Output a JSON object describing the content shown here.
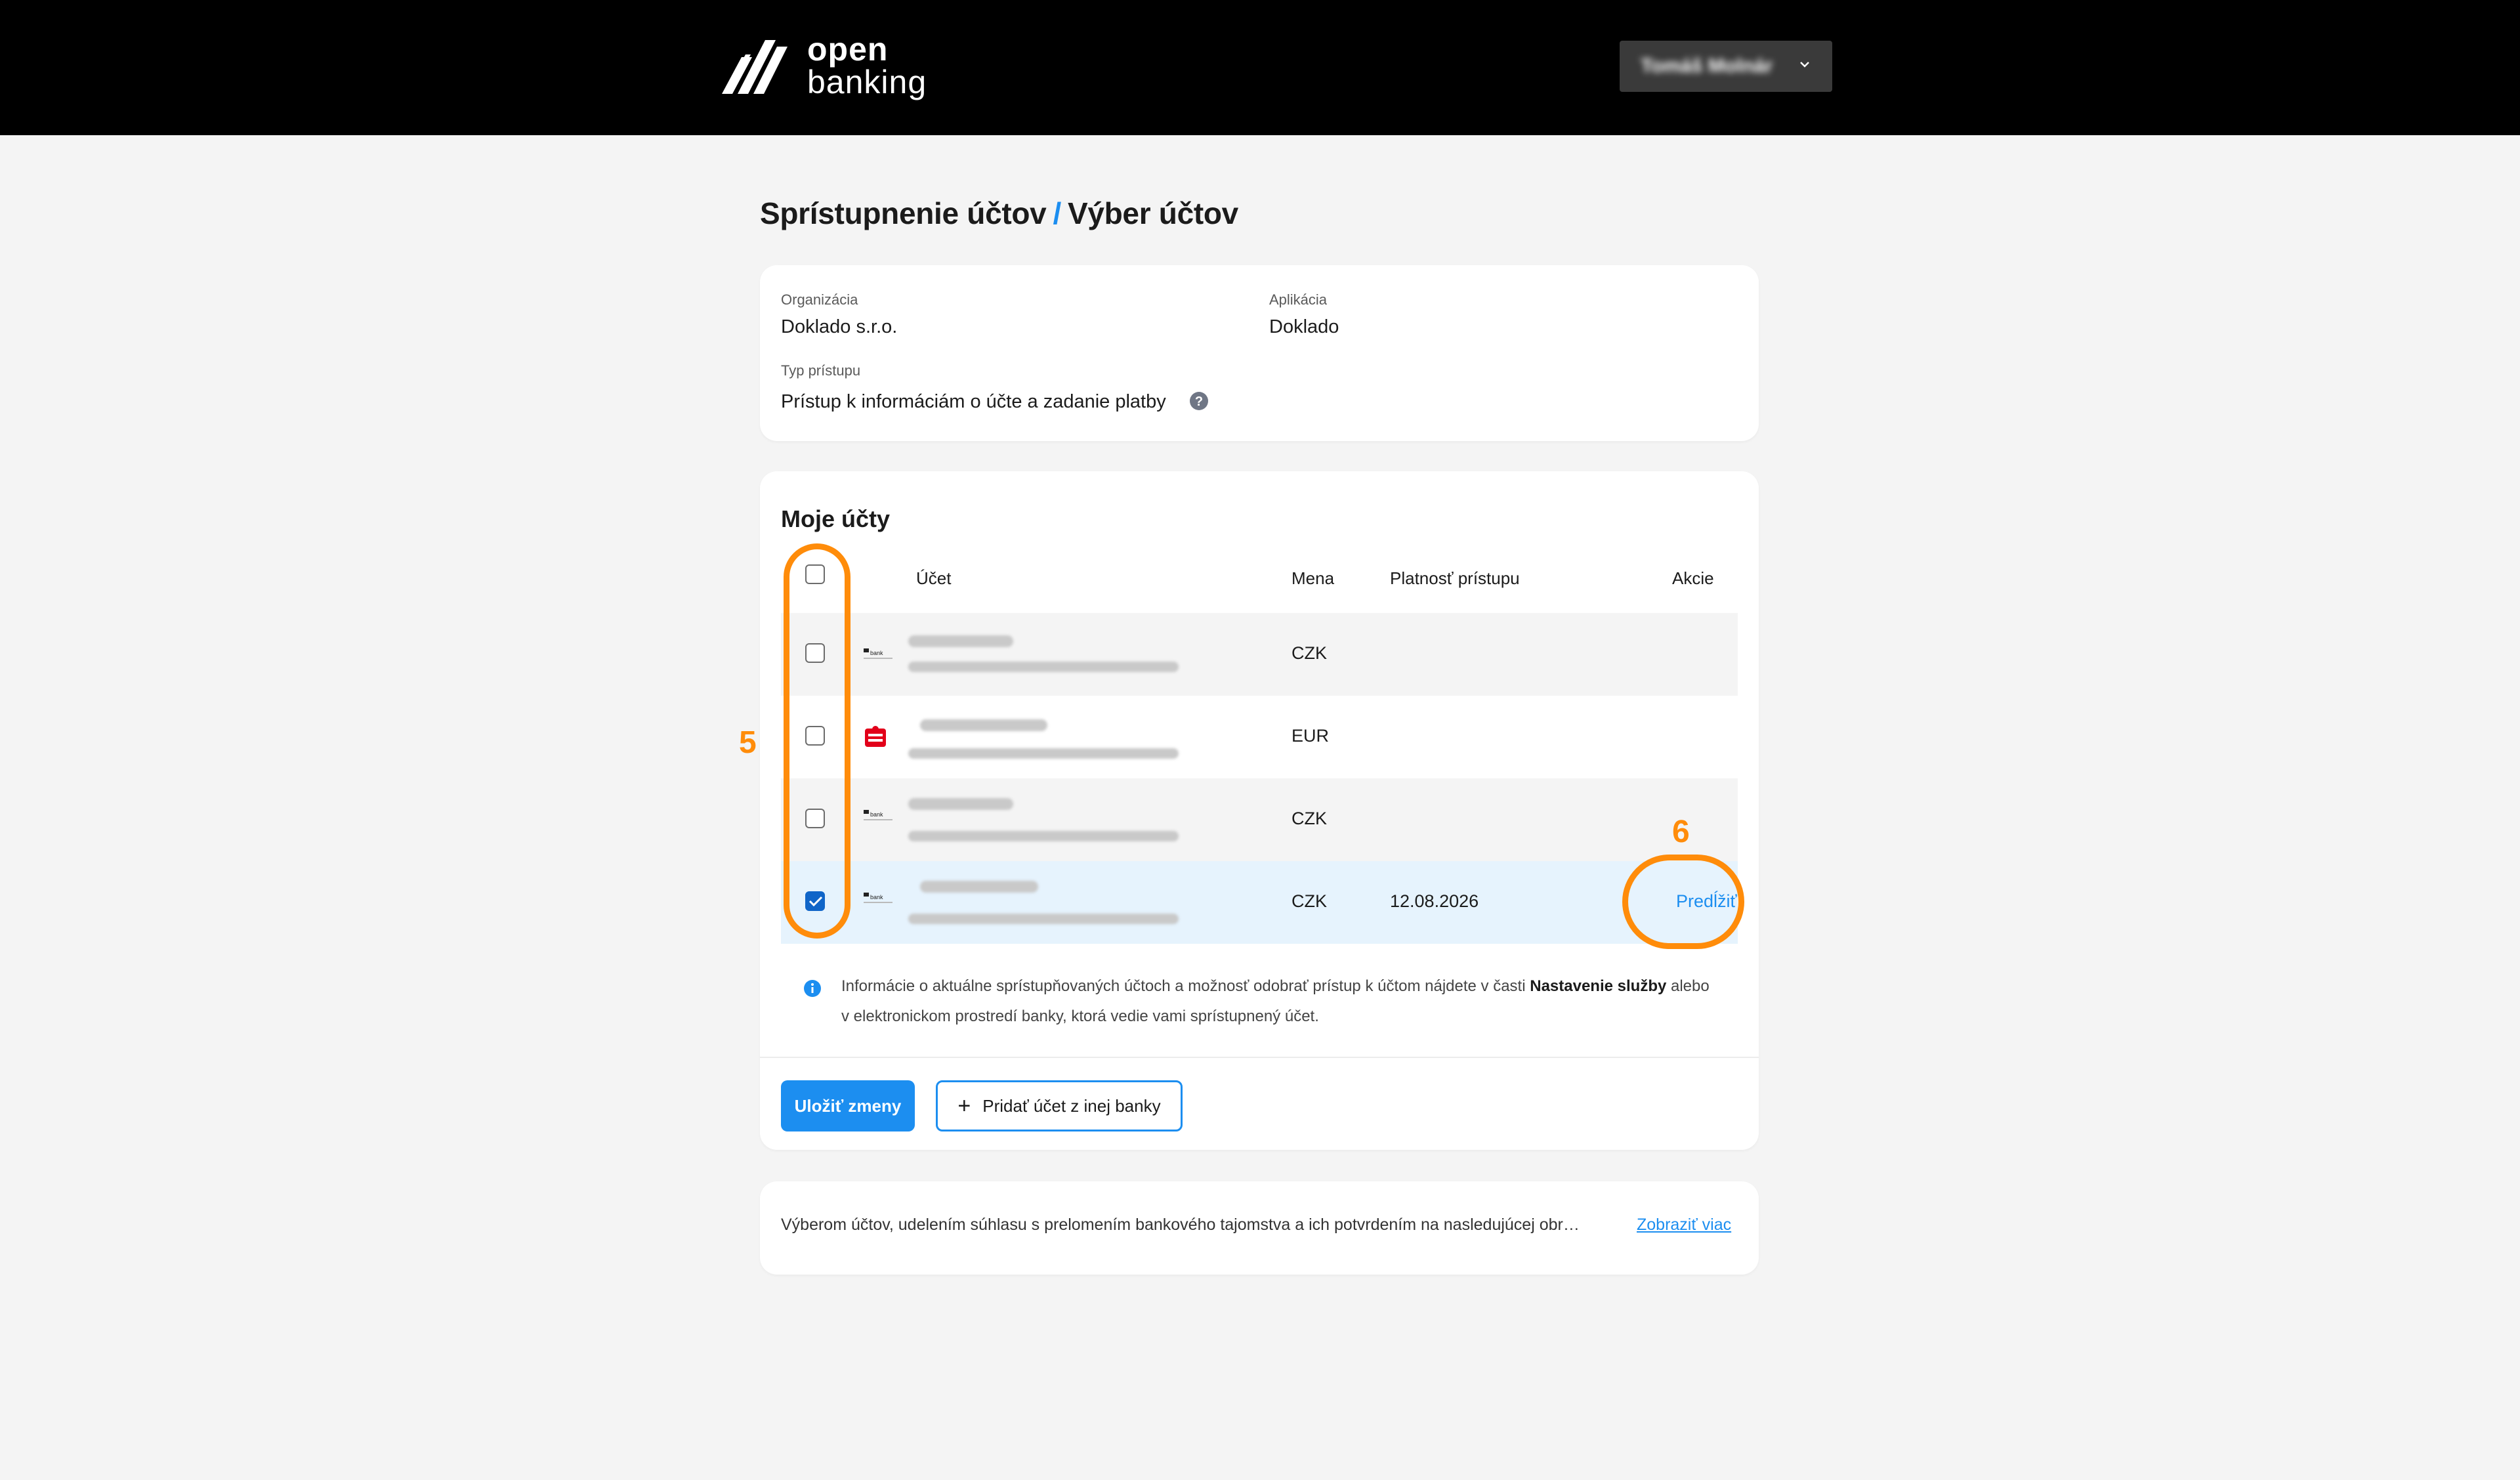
{
  "header": {
    "logo_line1": "open",
    "logo_line2": "banking",
    "user_name": "Tomáš Molnár"
  },
  "page": {
    "title_part1": "Sprístupnenie účtov",
    "title_separator": "/",
    "title_part2": "Výber účtov"
  },
  "info_card": {
    "organization_label": "Organizácia",
    "organization_value": "Doklado s.r.o.",
    "application_label": "Aplikácia",
    "application_value": "Doklado",
    "access_type_label": "Typ prístupu",
    "access_type_value": "Prístup k informáciám o účte a zadanie platby"
  },
  "accounts": {
    "title": "Moje účty",
    "columns": {
      "account": "Účet",
      "currency": "Mena",
      "validity": "Platnosť prístupu",
      "actions": "Akcie"
    },
    "rows": [
      {
        "currency": "CZK",
        "validity": "",
        "action": "",
        "checked": false
      },
      {
        "currency": "EUR",
        "validity": "",
        "action": "",
        "checked": false
      },
      {
        "currency": "CZK",
        "validity": "",
        "action": "",
        "checked": false
      },
      {
        "currency": "CZK",
        "validity": "12.08.2026",
        "action": "Predĺžiť",
        "checked": true
      }
    ],
    "note_part1": "Informácie o aktuálne sprístupňovaných účtoch a možnosť odobrať prístup k účtom nájdete v časti ",
    "note_bold": "Nastavenie služby",
    "note_part2": " alebo v elektronickom prostredí banky, ktorá vedie vami sprístupnený účet.",
    "save_button": "Uložiť zmeny",
    "add_button": "Pridať účet z inej banky"
  },
  "consent": {
    "text": "Výberom účtov, udelením súhlasu s prelomením bankového tajomstva a ich potvrdením na nasledujúcej obr…",
    "link": "Zobraziť viac"
  },
  "annotations": {
    "label_5": "5",
    "label_6": "6",
    "color": "#ff8c0a"
  },
  "colors": {
    "accent": "#1c8ef0",
    "header_bg": "#000000",
    "selected_row": "#e6f3fd",
    "bank2_red": "#e2001a"
  }
}
